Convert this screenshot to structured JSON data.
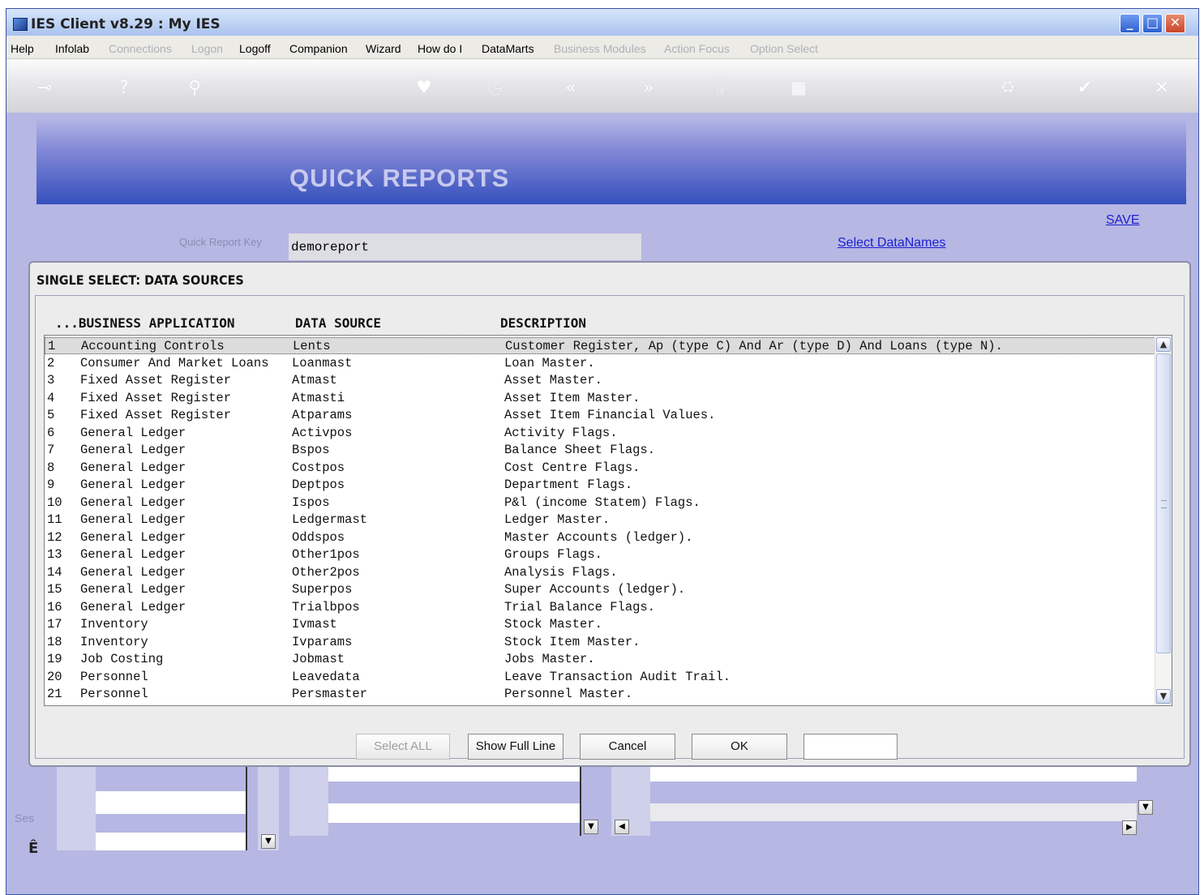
{
  "window": {
    "title": "IES Client v8.29 : My IES",
    "controls": {
      "minimize": "_",
      "maximize": "□",
      "close": "✕"
    }
  },
  "menu": [
    {
      "label": "Help",
      "enabled": true
    },
    {
      "label": "Infolab",
      "enabled": true
    },
    {
      "label": "Connections",
      "enabled": false
    },
    {
      "label": "Logon",
      "enabled": false
    },
    {
      "label": "Logoff",
      "enabled": true
    },
    {
      "label": "Companion",
      "enabled": true
    },
    {
      "label": "Wizard",
      "enabled": true
    },
    {
      "label": "How do I",
      "enabled": true
    },
    {
      "label": "DataMarts",
      "enabled": true
    },
    {
      "label": "Business Modules",
      "enabled": false
    },
    {
      "label": "Action Focus",
      "enabled": false
    },
    {
      "label": "Option Select",
      "enabled": false
    }
  ],
  "toolbar": {
    "icons": [
      "key-icon",
      "help-icon",
      "search-icon",
      "heart-icon",
      "clock-icon",
      "back-icon",
      "forward-icon",
      "tree-icon",
      "stop-icon",
      "recycle-icon",
      "check-icon",
      "close-icon"
    ],
    "glyphs": [
      "⊸",
      "?",
      "⚲",
      "♥",
      "◷",
      "«",
      "»",
      "⫼",
      "■",
      "♻",
      "✔",
      "✕"
    ]
  },
  "page": {
    "banner_title": "QUICK REPORTS",
    "save_link": "SAVE",
    "quick_report_key_label": "Quick Report Key",
    "quick_report_key_value": "demoreport",
    "select_datanames_link": "Select DataNames"
  },
  "dialog": {
    "title": "SINGLE SELECT: DATA SOURCES",
    "columns": {
      "application": "...BUSINESS APPLICATION",
      "source": "DATA SOURCE",
      "description": "DESCRIPTION"
    },
    "rows": [
      {
        "num": "1",
        "app": "Accounting Controls",
        "source": "Lents",
        "desc": "Customer Register, Ap (type C) And Ar (type D) And Loans (type N)."
      },
      {
        "num": "2",
        "app": "Consumer And Market Loans",
        "source": "Loanmast",
        "desc": "Loan Master."
      },
      {
        "num": "3",
        "app": "Fixed Asset Register",
        "source": "Atmast",
        "desc": "Asset Master."
      },
      {
        "num": "4",
        "app": "Fixed Asset Register",
        "source": "Atmasti",
        "desc": "Asset Item Master."
      },
      {
        "num": "5",
        "app": "Fixed Asset Register",
        "source": "Atparams",
        "desc": "Asset Item Financial Values."
      },
      {
        "num": "6",
        "app": "General Ledger",
        "source": "Activpos",
        "desc": "Activity Flags."
      },
      {
        "num": "7",
        "app": "General Ledger",
        "source": "Bspos",
        "desc": "Balance Sheet Flags."
      },
      {
        "num": "8",
        "app": "General Ledger",
        "source": "Costpos",
        "desc": "Cost Centre Flags."
      },
      {
        "num": "9",
        "app": "General Ledger",
        "source": "Deptpos",
        "desc": "Department Flags."
      },
      {
        "num": "10",
        "app": "General Ledger",
        "source": "Ispos",
        "desc": "P&l (income Statem) Flags."
      },
      {
        "num": "11",
        "app": "General Ledger",
        "source": "Ledgermast",
        "desc": "Ledger Master."
      },
      {
        "num": "12",
        "app": "General Ledger",
        "source": "Oddspos",
        "desc": "Master Accounts (ledger)."
      },
      {
        "num": "13",
        "app": "General Ledger",
        "source": "Other1pos",
        "desc": "Groups Flags."
      },
      {
        "num": "14",
        "app": "General Ledger",
        "source": "Other2pos",
        "desc": "Analysis Flags."
      },
      {
        "num": "15",
        "app": "General Ledger",
        "source": "Superpos",
        "desc": "Super Accounts (ledger)."
      },
      {
        "num": "16",
        "app": "General Ledger",
        "source": "Trialbpos",
        "desc": "Trial Balance Flags."
      },
      {
        "num": "17",
        "app": "Inventory",
        "source": "Ivmast",
        "desc": "Stock Master."
      },
      {
        "num": "18",
        "app": "Inventory",
        "source": "Ivparams",
        "desc": "Stock Item Master."
      },
      {
        "num": "19",
        "app": "Job Costing",
        "source": "Jobmast",
        "desc": "Jobs Master."
      },
      {
        "num": "20",
        "app": "Personnel",
        "source": "Leavedata",
        "desc": "Leave Transaction Audit Trail."
      },
      {
        "num": "21",
        "app": "Personnel",
        "source": "Persmaster",
        "desc": "Personnel Master."
      }
    ],
    "selected_index": 0,
    "buttons": {
      "select_all": "Select ALL",
      "show_full_line": "Show Full Line",
      "cancel": "Cancel",
      "ok": "OK"
    }
  },
  "background": {
    "ses_label": "Ses",
    "side_glyph": "Ê"
  }
}
